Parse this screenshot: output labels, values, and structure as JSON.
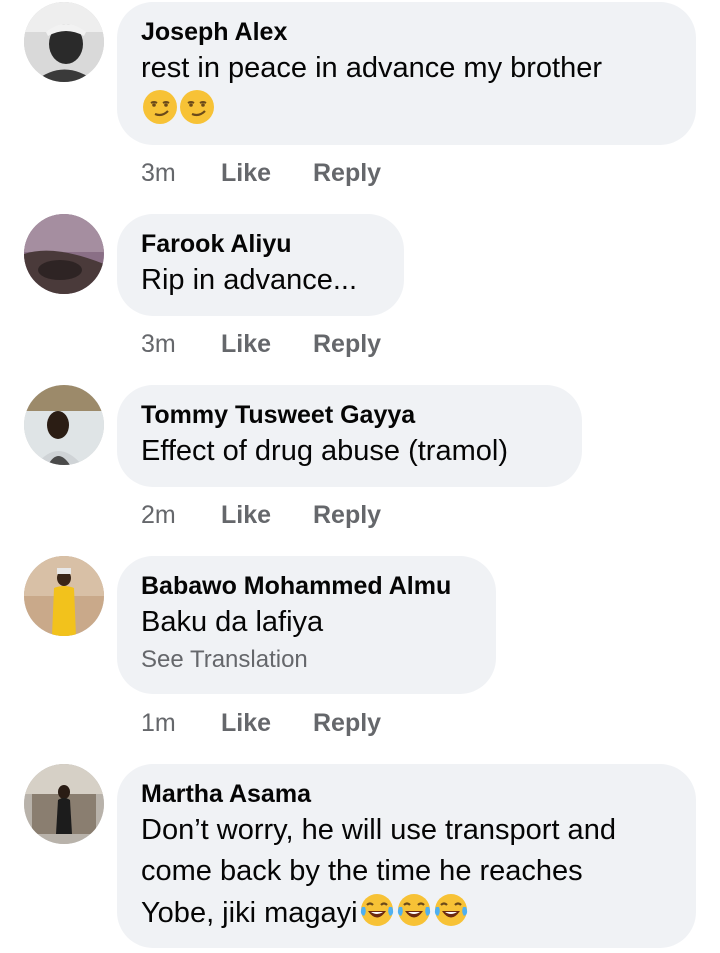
{
  "comments": [
    {
      "author": "Joseph Alex",
      "text": "rest in peace in advance my brother",
      "emoji": [
        "smirk-emoji",
        "smirk-emoji"
      ],
      "time": "3m",
      "like_label": "Like",
      "reply_label": "Reply"
    },
    {
      "author": "Farook Aliyu",
      "text": "Rip in advance...",
      "time": "3m",
      "like_label": "Like",
      "reply_label": "Reply"
    },
    {
      "author": "Tommy Tusweet Gayya",
      "text": "Effect of drug abuse (tramol)",
      "time": "2m",
      "like_label": "Like",
      "reply_label": "Reply"
    },
    {
      "author": "Babawo Mohammed Almu",
      "text": "Baku da lafiya",
      "see_translation": "See Translation",
      "time": "1m",
      "like_label": "Like",
      "reply_label": "Reply"
    },
    {
      "author": "Martha Asama",
      "text_lines": [
        "Don’t worry, he will use transport and",
        "come back by the time he reaches",
        "Yobe, jiki magayi"
      ],
      "emoji": [
        "tears-of-joy-emoji",
        "tears-of-joy-emoji",
        "tears-of-joy-emoji"
      ]
    }
  ],
  "colors": {
    "bubble": "#f0f2f5",
    "name": "#050505",
    "meta": "#65676b"
  }
}
